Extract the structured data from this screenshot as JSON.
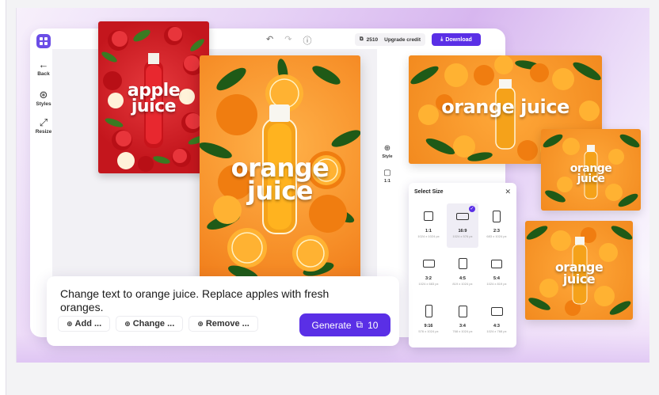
{
  "editor": {
    "toolbar": [
      {
        "label": "Back",
        "icon": "back-arrow-icon"
      },
      {
        "label": "Styles",
        "icon": "styles-icon"
      },
      {
        "label": "Resize",
        "icon": "resize-icon"
      }
    ],
    "credits": {
      "count": "2510",
      "upgrade_label": "Upgrade credit"
    },
    "download_label": "Download",
    "side_tools": [
      {
        "label": "Style",
        "icon": "style-icon"
      },
      {
        "label": "1:1",
        "icon": "aspect-square-icon"
      }
    ]
  },
  "posters": {
    "apple": {
      "line1": "apple",
      "line2": "juice"
    },
    "orange": {
      "line1": "orange",
      "line2": "juice"
    },
    "landscape1": {
      "text": "orange juice"
    },
    "landscape2": {
      "line1": "orange",
      "line2": "juice"
    },
    "landscape3": {
      "line1": "orange",
      "line2": "juice"
    }
  },
  "size_panel": {
    "title": "Select Size",
    "sizes": [
      {
        "ratio": "1:1",
        "dims": "1024 x 1024 px",
        "selected": false
      },
      {
        "ratio": "16:9",
        "dims": "1024 x 576 px",
        "selected": true
      },
      {
        "ratio": "2:3",
        "dims": "683 x 1024 px",
        "selected": false
      },
      {
        "ratio": "3:2",
        "dims": "1024 x 683 px",
        "selected": false
      },
      {
        "ratio": "4:5",
        "dims": "819 x 1024 px",
        "selected": false
      },
      {
        "ratio": "5:4",
        "dims": "1024 x 819 px",
        "selected": false
      },
      {
        "ratio": "9:16",
        "dims": "576 x 1024 px",
        "selected": false
      },
      {
        "ratio": "3:4",
        "dims": "768 x 1024 px",
        "selected": false
      },
      {
        "ratio": "4:3",
        "dims": "1024 x 768 px",
        "selected": false
      }
    ]
  },
  "prompt": {
    "text": "Change text to orange juice. Replace apples with fresh oranges.",
    "chips": [
      "Add ...",
      "Change ...",
      "Remove ..."
    ],
    "generate_label": "Generate",
    "generate_cost": "10"
  },
  "colors": {
    "accent": "#5a2fe6",
    "apple_bg": "#d11f26",
    "orange_bg": "#f7912a"
  }
}
